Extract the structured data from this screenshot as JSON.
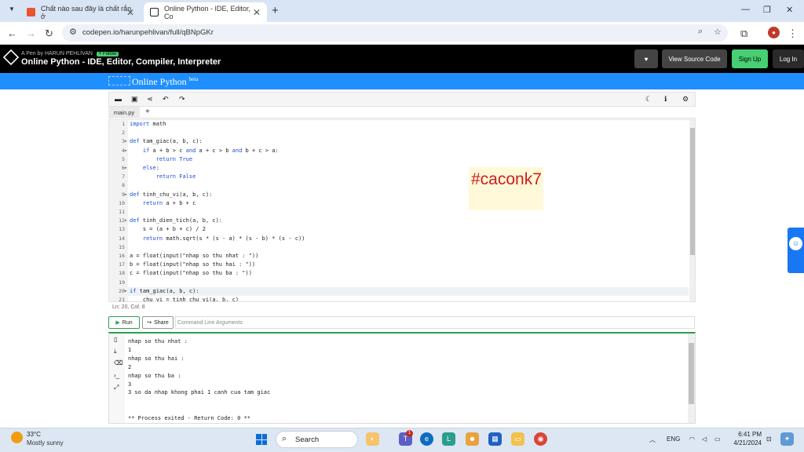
{
  "browser": {
    "tabs": [
      {
        "title": "Chất nào sau đây là chất rắn ở",
        "icon": "studocu-favicon-icon",
        "active": false
      },
      {
        "title": "Online Python - IDE, Editor, Co",
        "icon": "codepen-favicon-icon",
        "active": true
      }
    ],
    "url": "codepen.io/harunpehlivan/full/qBNpGKr"
  },
  "codepen": {
    "byline_prefix": "A Pen by",
    "author": "HARUN PEHLİVAN",
    "follow_label": "+ Follow",
    "pen_title": "Online Python - IDE, Editor, Compiler, Interpreter",
    "view_source_label": "View Source Code",
    "signup_label": "Sign Up",
    "login_label": "Log In"
  },
  "app": {
    "title": "Online Python",
    "title_sup": "beta",
    "file_tab": "main.py",
    "status": "Ln: 20,  Col: 8",
    "run_label": "Run",
    "share_label": "Share",
    "args_placeholder": "Command Line Arguments"
  },
  "code_lines": [
    "import math",
    "",
    "def tam_giac(a, b, c):",
    "    if a + b > c and a + c > b and b + c > a:",
    "        return True",
    "    else:",
    "        return False",
    "",
    "def tinh_chu_vi(a, b, c):",
    "    return a + b + c",
    "",
    "def tinh_dien_tich(a, b, c):",
    "    s = (a + b + c) / 2",
    "    return math.sqrt(s * (s - a) * (s - b) * (s - c))",
    "",
    "a = float(input(\"nhap so thu nhat : \"))",
    "b = float(input(\"nhap so thu hai : \"))",
    "c = float(input(\"nhap so thu ba : \"))",
    "",
    "if tam_giac(a, b, c):",
    "    chu_vi = tinh_chu_vi(a, b, c)"
  ],
  "line_numbers": [
    "1",
    "2",
    "3",
    "4",
    "5",
    "6",
    "7",
    "8",
    "9",
    "10",
    "11",
    "12",
    "13",
    "14",
    "15",
    "16",
    "17",
    "18",
    "19",
    "20",
    "21"
  ],
  "fold_markers": [
    "",
    "",
    "▾",
    "▾",
    "",
    "▾",
    "",
    "",
    "▾",
    "",
    "",
    "▾",
    "",
    "",
    "",
    "",
    "",
    "",
    "",
    "▾",
    ""
  ],
  "console_lines": [
    "nhap so thu nhat :",
    "1",
    "nhap so thu hai :",
    "2",
    "nhap so thu ba :",
    "3",
    "3 so da nhap khong phai 1 canh cua tam giac",
    "",
    "",
    "** Process exited - Return Code: 0 **"
  ],
  "overlay_tag": "#caconk7",
  "taskbar": {
    "temperature": "33°C",
    "weather": "Mostly sunny",
    "search_label": "Search",
    "language": "ENG",
    "time": "6:41 PM",
    "date": "4/21/2024",
    "teams_badge": "1"
  },
  "colors": {
    "codepen_bg": "#000000",
    "accent_blue": "#1f8fff",
    "signup_green": "#47cf73",
    "run_green": "#2e9e4f",
    "keyword": "#1c4ed8",
    "tag_red": "#d01c1c"
  }
}
